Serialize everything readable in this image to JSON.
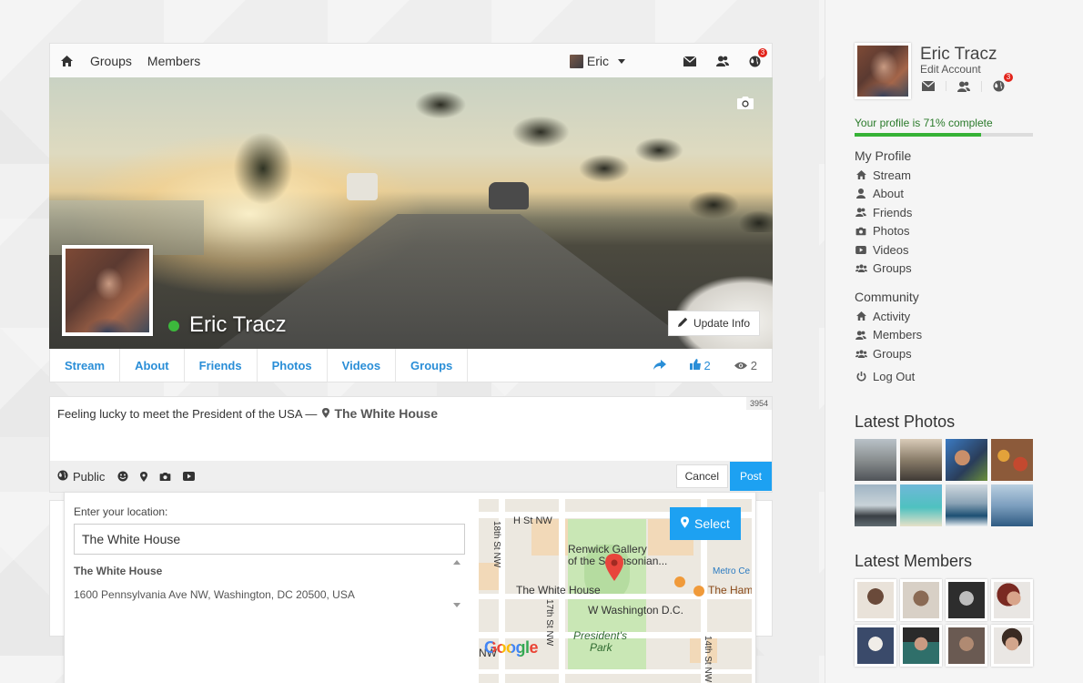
{
  "topbar": {
    "links": [
      "Groups",
      "Members"
    ],
    "user_name": "Eric",
    "notification_count": "3"
  },
  "profile": {
    "name": "Eric Tracz",
    "update_info_label": "Update Info",
    "tabs": [
      "Stream",
      "About",
      "Friends",
      "Photos",
      "Videos",
      "Groups"
    ],
    "likes": "2",
    "views": "2"
  },
  "composer": {
    "text": "Feeling lucky to meet the President of the USA —",
    "location": "The White House",
    "char_counter": "3954",
    "privacy": "Public",
    "cancel_label": "Cancel",
    "post_label": "Post"
  },
  "location_picker": {
    "label": "Enter your location:",
    "input_value": "The White House",
    "result_title": "The White House",
    "result_address": "1600 Pennsylvania Ave NW, Washington, DC 20500, USA",
    "select_label": "Select",
    "map_labels": {
      "h_st": "H St NW",
      "st18": "18th St NW",
      "st17": "17th St NW",
      "st14": "14th St NW",
      "renwick1": "Renwick Gallery",
      "renwick2": "of the Smithsonian...",
      "white_house": "The White House",
      "w_washington": "W Washington D.C.",
      "metro": "Metro Ce",
      "the_ham": "The Ham",
      "presidents1": "President's",
      "presidents2": "Park",
      "nw": "NW",
      "google": "Google"
    }
  },
  "sidebar": {
    "name": "Eric Tracz",
    "edit_label": "Edit Account",
    "notification_count": "3",
    "progress_text": "Your profile is 71% complete",
    "progress_fraction": 0.71,
    "my_profile_heading": "My Profile",
    "my_profile_items": [
      "Stream",
      "About",
      "Friends",
      "Photos",
      "Videos",
      "Groups"
    ],
    "community_heading": "Community",
    "community_items": [
      "Activity",
      "Members",
      "Groups"
    ],
    "logout_label": "Log Out",
    "latest_photos_heading": "Latest Photos",
    "latest_members_heading": "Latest Members"
  },
  "colors": {
    "accent": "#1da1f2",
    "link": "#2a8ed7",
    "online": "#3cb93c",
    "badge": "#e2231a",
    "progress": "#36b236"
  }
}
